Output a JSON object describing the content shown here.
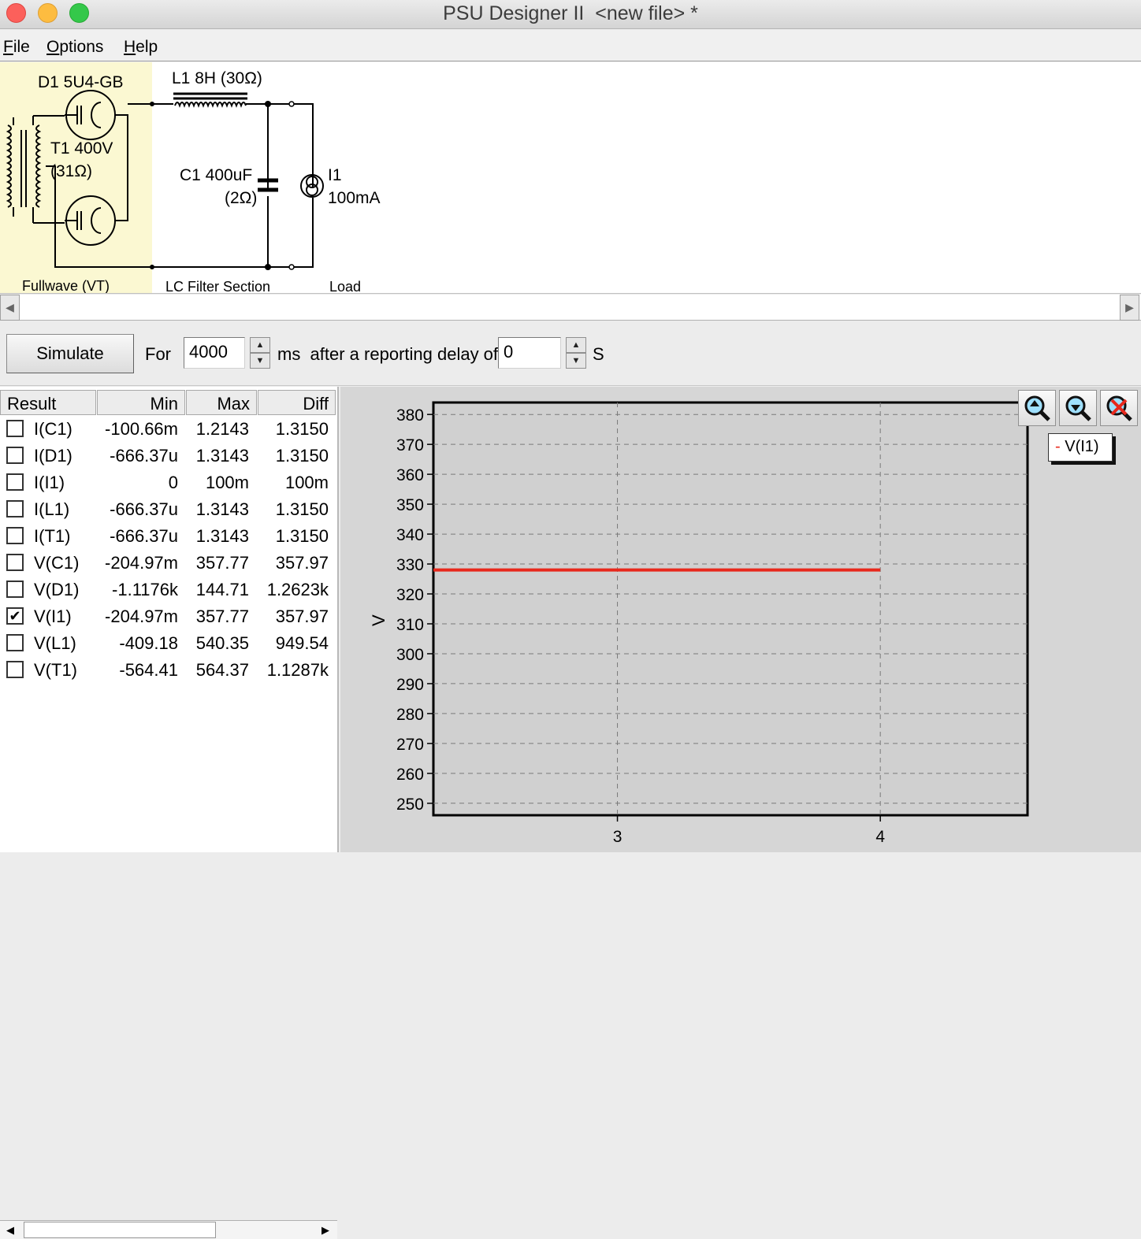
{
  "window": {
    "title": "PSU Designer II  <new file> *"
  },
  "menu": [
    {
      "label": "File",
      "u": "F",
      "rest": "ile"
    },
    {
      "label": "Options",
      "u": "O",
      "rest": "ptions"
    },
    {
      "label": "Help",
      "u": "H",
      "rest": "elp"
    }
  ],
  "schematic": {
    "d1_label": "D1 5U4-GB",
    "t1_label": "T1 400V",
    "t1_sub": "(31Ω)",
    "l1_label": "L1 8H (30Ω)",
    "c1_label": "C1 400uF",
    "c1_sub": "(2Ω)",
    "i1_label": "I1",
    "i1_value": "100mA",
    "section_rectifier": "Fullwave (VT)",
    "section_filter": "LC Filter Section",
    "section_load": "Load"
  },
  "simulate": {
    "button_label": "Simulate",
    "for_label": "For",
    "duration": "4000",
    "ms_label": "ms  after a reporting delay of",
    "delay": "0",
    "s_label": "S"
  },
  "results": {
    "headers": [
      "Result",
      "Min",
      "Max",
      "Diff"
    ],
    "rows": [
      {
        "checked": false,
        "name": "I(C1)",
        "min": "-100.66m",
        "max": "1.2143",
        "diff": "1.3150"
      },
      {
        "checked": false,
        "name": "I(D1)",
        "min": "-666.37u",
        "max": "1.3143",
        "diff": "1.3150"
      },
      {
        "checked": false,
        "name": "I(I1)",
        "min": "0",
        "max": "100m",
        "diff": "100m"
      },
      {
        "checked": false,
        "name": "I(L1)",
        "min": "-666.37u",
        "max": "1.3143",
        "diff": "1.3150"
      },
      {
        "checked": false,
        "name": "I(T1)",
        "min": "-666.37u",
        "max": "1.3143",
        "diff": "1.3150"
      },
      {
        "checked": false,
        "name": "V(C1)",
        "min": "-204.97m",
        "max": "357.77",
        "diff": "357.97"
      },
      {
        "checked": false,
        "name": "V(D1)",
        "min": "-1.1176k",
        "max": "144.71",
        "diff": "1.2623k"
      },
      {
        "checked": true,
        "name": "V(I1)",
        "min": "-204.97m",
        "max": "357.77",
        "diff": "357.97"
      },
      {
        "checked": false,
        "name": "V(L1)",
        "min": "-409.18",
        "max": "540.35",
        "diff": "949.54"
      },
      {
        "checked": false,
        "name": "V(T1)",
        "min": "-564.41",
        "max": "564.37",
        "diff": "1.1287k"
      }
    ]
  },
  "chart_data": {
    "type": "line",
    "ylabel": "V",
    "xlabel": "",
    "xlim": [
      2.3,
      4.56
    ],
    "ylim": [
      246,
      384
    ],
    "x_ticks": [
      3,
      4
    ],
    "y_ticks": [
      250,
      260,
      270,
      280,
      290,
      300,
      310,
      320,
      330,
      340,
      350,
      360,
      370,
      380
    ],
    "grid": true,
    "legend_position": "top-right",
    "series": [
      {
        "name": "V(I1)",
        "color": "#e8281c",
        "x": [
          2.3,
          4.0
        ],
        "y": [
          328,
          328
        ]
      }
    ]
  },
  "icons": {
    "zoom_in": "zoom-in-icon",
    "zoom_out": "zoom-out-icon",
    "zoom_reset": "zoom-reset-icon"
  }
}
